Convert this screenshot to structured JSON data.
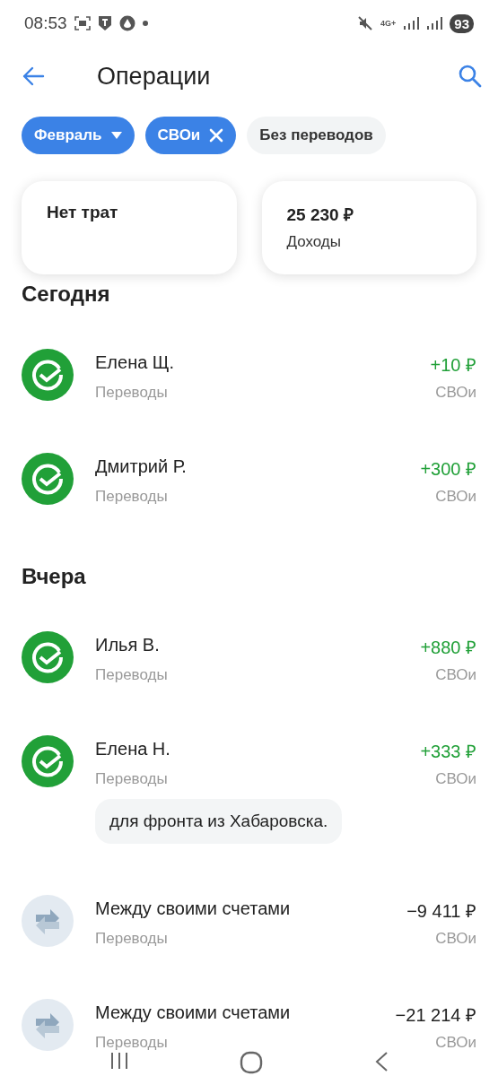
{
  "status_bar": {
    "time": "08:53",
    "network": "4G+",
    "battery": "93"
  },
  "header": {
    "title": "Операции"
  },
  "filters": [
    {
      "label": "Февраль",
      "selected": true,
      "kind": "dropdown"
    },
    {
      "label": "СВОи",
      "selected": true,
      "kind": "removable"
    },
    {
      "label": "Без переводов",
      "selected": false,
      "kind": "toggle"
    }
  ],
  "summary": [
    {
      "title": "Нет трат"
    },
    {
      "amount": "25 230 ₽",
      "title": "Доходы"
    }
  ],
  "groups": [
    {
      "title": "Сегодня",
      "operations": [
        {
          "kind": "income",
          "name": "Елена Щ.",
          "category": "Переводы",
          "amount": "+10 ₽",
          "account": "СВОи"
        },
        {
          "kind": "income",
          "name": "Дмитрий Р.",
          "category": "Переводы",
          "amount": "+300 ₽",
          "account": "СВОи"
        }
      ]
    },
    {
      "title": "Вчера",
      "operations": [
        {
          "kind": "income",
          "name": "Илья В.",
          "category": "Переводы",
          "amount": "+880 ₽",
          "account": "СВОи"
        },
        {
          "kind": "income",
          "name": "Елена Н.",
          "category": "Переводы",
          "amount": "+333 ₽",
          "account": "СВОи",
          "note": "для фронта из Хабаровска."
        },
        {
          "kind": "transfer",
          "name": "Между своими счетами",
          "category": "Переводы",
          "amount": "−9 411 ₽",
          "account": "СВОи"
        },
        {
          "kind": "transfer",
          "name": "Между своими счетами",
          "category": "Переводы",
          "amount": "−21 214 ₽",
          "account": "СВОи"
        }
      ]
    }
  ]
}
